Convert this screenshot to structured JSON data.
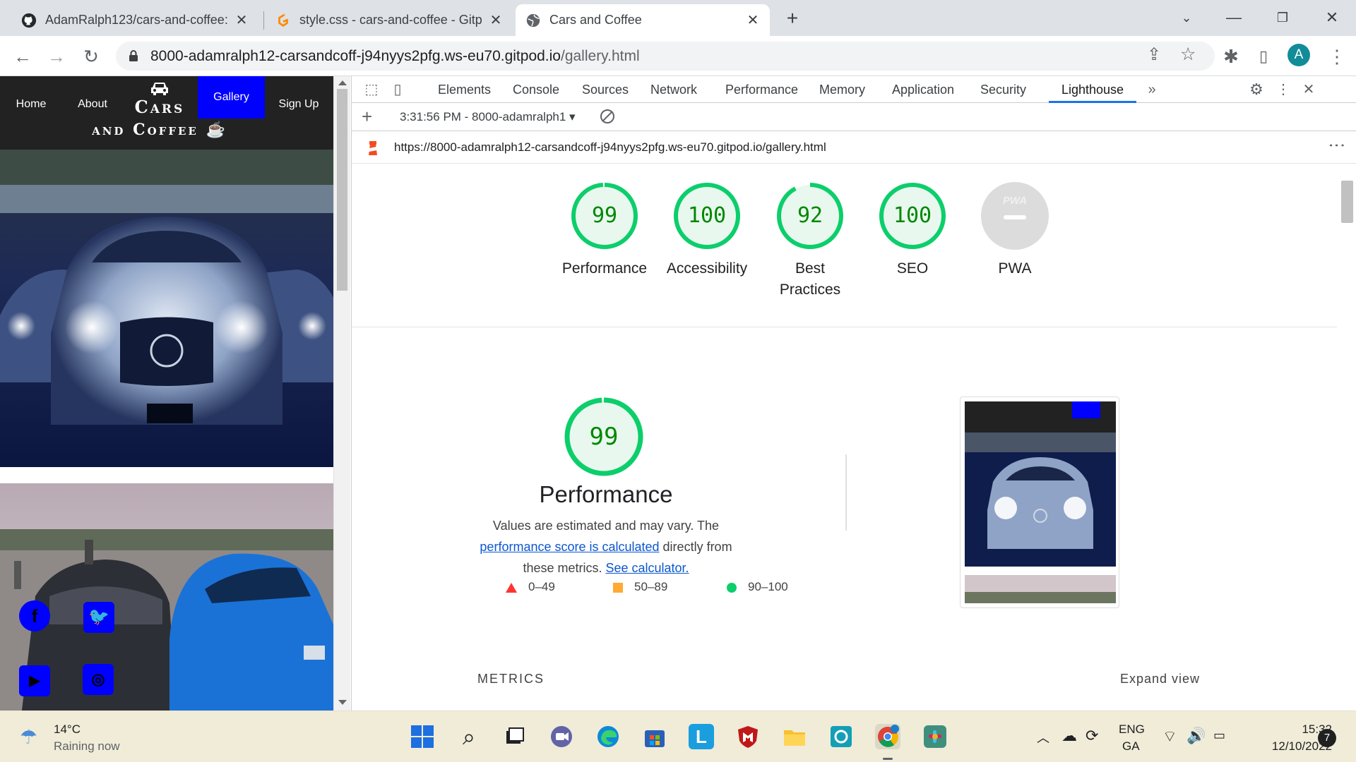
{
  "browser": {
    "tabs": [
      {
        "title": "AdamRalph123/cars-and-coffee:",
        "icon": "github-icon"
      },
      {
        "title": "style.css - cars-and-coffee - Gitpo",
        "icon": "gitpod-icon"
      },
      {
        "title": "Cars and Coffee",
        "icon": "globe-icon",
        "active": true
      }
    ],
    "new_tab": "+",
    "url_host": "8000-adamralph12-carsandcoff-j94nyys2pfg.ws-eu70.gitpod.io",
    "url_path": "/gallery.html",
    "avatar_letter": "A"
  },
  "site": {
    "nav": {
      "home": "Home",
      "about": "About",
      "gallery": "Gallery",
      "signup": "Sign Up"
    },
    "brand_line1": "Cars",
    "brand_line2": "and Coffee",
    "accent": "#0000ff"
  },
  "devtools": {
    "tabs": [
      "Elements",
      "Console",
      "Sources",
      "Network",
      "Performance",
      "Memory",
      "Application",
      "Security",
      "Lighthouse"
    ],
    "active_tab": "Lighthouse",
    "report_select": "3:31:56 PM - 8000-adamralph1",
    "report_url": "https://8000-adamralph12-carsandcoff-j94nyys2pfg.ws-eu70.gitpod.io/gallery.html",
    "categories": [
      {
        "score": "99",
        "label": "Performance"
      },
      {
        "score": "100",
        "label": "Accessibility"
      },
      {
        "score": "92",
        "label": "Best Practices"
      },
      {
        "score": "100",
        "label": "SEO"
      },
      {
        "score": "",
        "label": "PWA",
        "badge": "PWA"
      }
    ],
    "performance": {
      "score": "99",
      "title": "Performance",
      "desc_1": "Values are estimated and may vary. The ",
      "link_1": "performance score is calculated",
      "desc_2": " directly from these metrics. ",
      "link_2": "See calculator."
    },
    "legend": [
      {
        "range": "0–49",
        "color": "#ff3333",
        "shape": "triangle"
      },
      {
        "range": "50–89",
        "color": "#ffaa33",
        "shape": "square"
      },
      {
        "range": "90–100",
        "color": "#0cce6b",
        "shape": "circle"
      }
    ],
    "metrics_label": "METRICS",
    "expand_label": "Expand view",
    "pass_color": "#0cce6b"
  },
  "taskbar": {
    "temp": "14°C",
    "condition": "Raining now",
    "lang1": "ENG",
    "lang2": "GA",
    "time": "15:32",
    "date": "12/10/2022",
    "notifications": "7"
  }
}
